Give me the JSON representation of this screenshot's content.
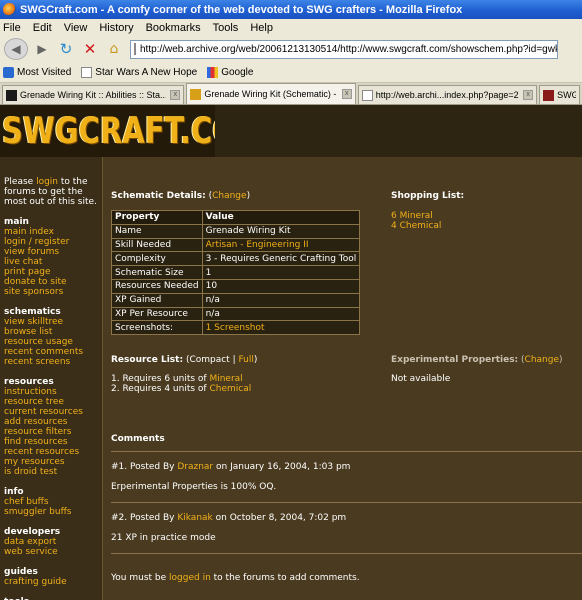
{
  "browser": {
    "title": "SWGCraft.com - A comfy corner of the web devoted to SWG crafters - Mozilla Firefox",
    "menu": [
      "File",
      "Edit",
      "View",
      "History",
      "Bookmarks",
      "Tools",
      "Help"
    ],
    "url": "http://web.archive.org/web/20061213130514/http://www.swgcraft.com/showschem.php?id=gwk",
    "bookmarks": [
      "Most Visited",
      "Star Wars A New Hope",
      "Google"
    ],
    "tabs": [
      "Grenade Wiring Kit :: Abilities :: Sta...",
      "Grenade Wiring Kit (Schematic) - S...",
      "http://web.archi...index.php?page=2",
      "SWGCraft"
    ]
  },
  "site": {
    "logo": "SWGCRAFT.COM",
    "sidebar": {
      "intro_pre": "Please ",
      "intro_link": "login",
      "intro_post": " to the forums to get the most out of this site.",
      "sections": [
        {
          "title": "main",
          "items": [
            "main index",
            "login / register",
            "view forums",
            "live chat",
            "print page",
            "donate to site",
            "site sponsors"
          ]
        },
        {
          "title": "schematics",
          "items": [
            "view skilltree",
            "browse list",
            "resource usage",
            "recent comments",
            "recent screens"
          ]
        },
        {
          "title": "resources",
          "items": [
            "instructions",
            "resource tree",
            "current resources",
            "add resources",
            "resource filters",
            "find resources",
            "recent resources",
            "my resources",
            "is droid test"
          ]
        },
        {
          "title": "info",
          "items": [
            "chef buffs",
            "smuggler buffs"
          ]
        },
        {
          "title": "developers",
          "items": [
            "data export",
            "web service"
          ]
        },
        {
          "title": "guides",
          "items": [
            "crafting guide"
          ]
        },
        {
          "title": "tools",
          "items": []
        }
      ]
    },
    "details": {
      "heading": "Schematic Details:",
      "change": "Change",
      "col_property": "Property",
      "col_value": "Value",
      "rows": [
        {
          "prop": "Name",
          "value": "Grenade Wiring Kit",
          "link": false
        },
        {
          "prop": "Skill Needed",
          "value": "Artisan - Engineering II",
          "link": true
        },
        {
          "prop": "Complexity",
          "value": "3 - Requires Generic Crafting Tool",
          "link": false
        },
        {
          "prop": "Schematic Size",
          "value": "1",
          "link": false
        },
        {
          "prop": "Resources Needed",
          "value": "10",
          "link": false
        },
        {
          "prop": "XP Gained",
          "value": "n/a",
          "link": false
        },
        {
          "prop": "XP Per Resource",
          "value": "n/a",
          "link": false
        },
        {
          "prop": "Screenshots:",
          "value": "1 Screenshot",
          "link": true
        }
      ]
    },
    "shopping": {
      "heading": "Shopping List:",
      "items": [
        "6 Mineral",
        "4 Chemical"
      ]
    },
    "resources": {
      "heading": "Resource List:",
      "compact": "Compact",
      "full": "Full",
      "items": [
        {
          "pre": "1. Requires 6 units of ",
          "link": "Mineral"
        },
        {
          "pre": "2. Requires 4 units of ",
          "link": "Chemical"
        }
      ]
    },
    "experimental": {
      "heading": "Experimental Properties:",
      "change": "Change",
      "value": "Not available"
    },
    "comments": {
      "heading": "Comments",
      "list": [
        {
          "num": "#1.",
          "posted_by": "Posted By",
          "author": "Draznar",
          "date": "on January 16, 2004, 1:03 pm",
          "text": "Erperimental Properties is 100% OQ."
        },
        {
          "num": "#2.",
          "posted_by": "Posted By",
          "author": "Kikanak",
          "date": "on October 8, 2004, 7:02 pm",
          "text": "21 XP in practice mode"
        }
      ],
      "must_pre": "You must be ",
      "must_link": "logged in",
      "must_post": " to the forums to add comments."
    }
  },
  "colors": {
    "accent": "#f0b018",
    "page_bg": "#4a3b20",
    "sidebar_bg": "#3a2e18"
  }
}
